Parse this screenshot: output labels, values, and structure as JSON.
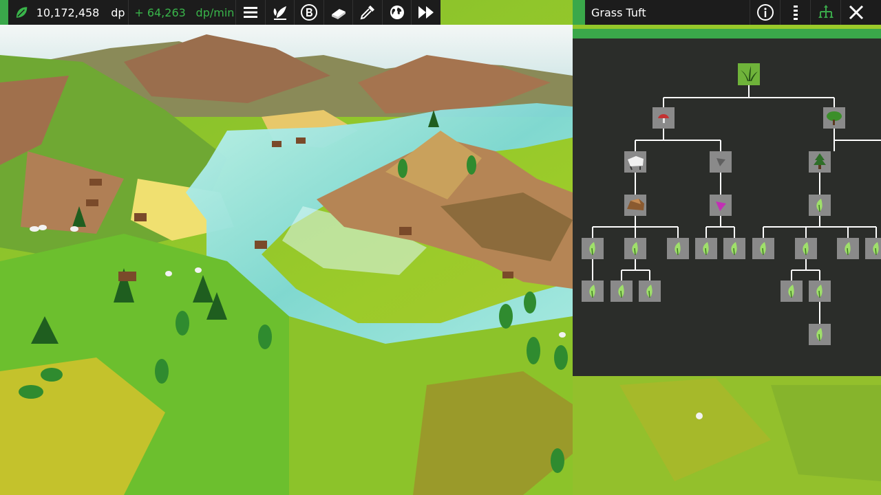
{
  "status": {
    "dp_value": "10,172,458",
    "dp_unit": "dp",
    "rate_value": "+ 64,263",
    "rate_unit": "dp/min"
  },
  "toolbar": {
    "buttons": [
      "menu-icon",
      "plant-icon",
      "b-icon",
      "book-icon",
      "dropper-icon",
      "globe-icon",
      "fast-forward-icon"
    ]
  },
  "panel": {
    "title": "Grass Tuft",
    "buttons": [
      "info-icon",
      "more-vertical-icon",
      "tree-hierarchy-icon",
      "close-icon"
    ]
  },
  "colors": {
    "accent": "#3aa84a",
    "bar_bg": "#1c1c1c",
    "panel_bg": "#2b2d2a",
    "node_bg": "#8a8a8a",
    "node_selected": "#6fb33a",
    "rate_text": "#39b54a"
  }
}
